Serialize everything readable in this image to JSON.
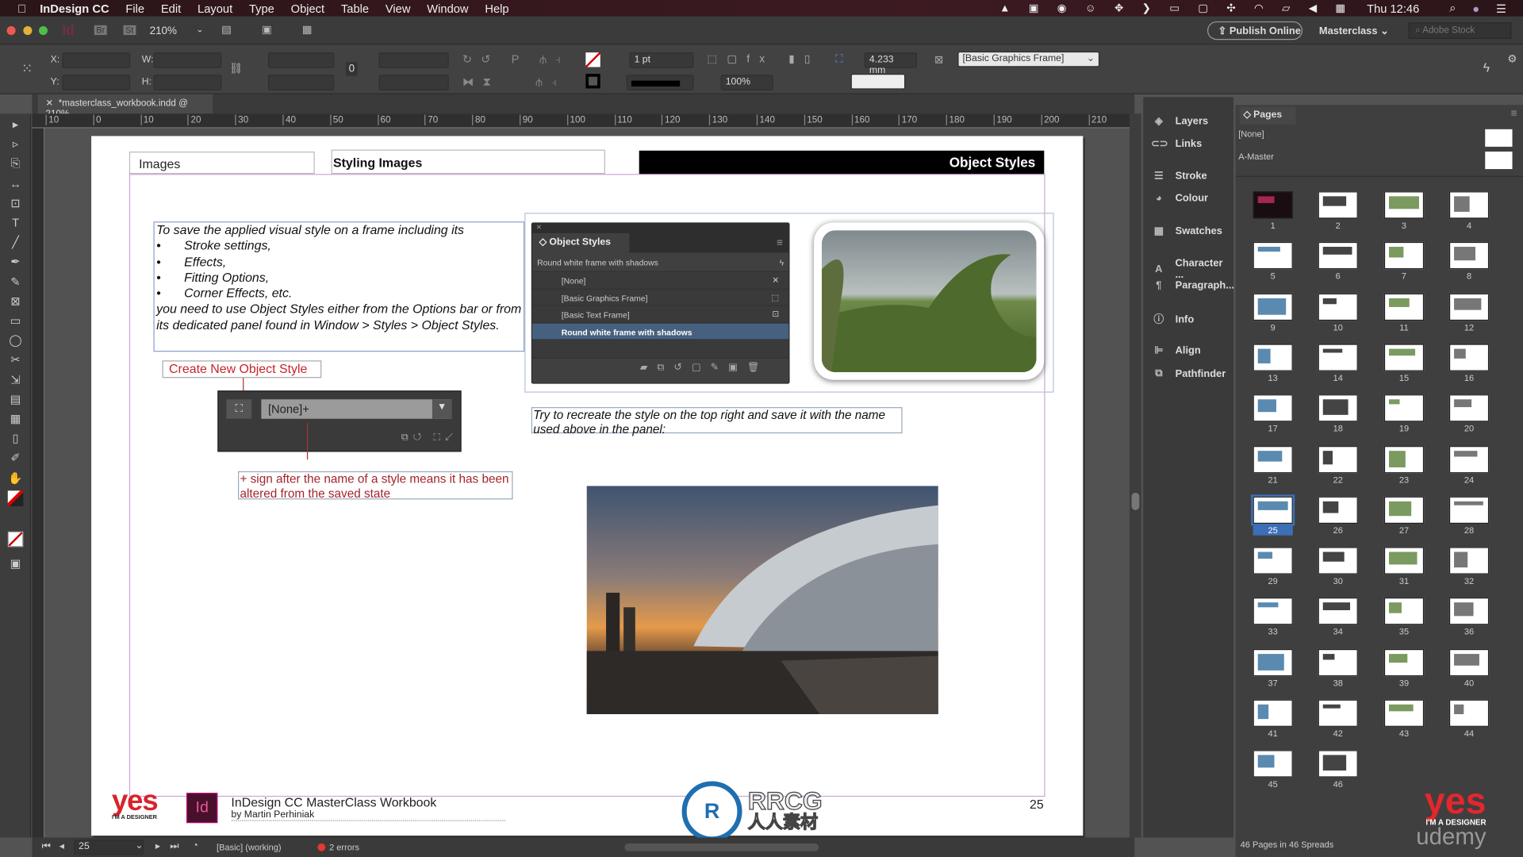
{
  "menubar": {
    "app": "InDesign CC",
    "items": [
      "File",
      "Edit",
      "Layout",
      "Type",
      "Object",
      "Table",
      "View",
      "Window",
      "Help"
    ],
    "clock": "Thu 12:46"
  },
  "appbar": {
    "bridge": "Br",
    "stock_btn": "St",
    "zoom": "210%",
    "publish": "Publish Online",
    "workspace": "Masterclass",
    "search_placeholder": "Adobe Stock"
  },
  "control": {
    "x_label": "X:",
    "y_label": "Y:",
    "w_label": "W:",
    "h_label": "H:",
    "stroke_weight": "1 pt",
    "opacity": "100%",
    "corner": "4.233 mm",
    "object_style": "[Basic Graphics Frame]"
  },
  "document_tab": "*masterclass_workbook.indd @ 210%",
  "ruler_labels": [
    "10",
    "0",
    "10",
    "20",
    "30",
    "40",
    "50",
    "60",
    "70",
    "80",
    "90",
    "100",
    "110",
    "120",
    "130",
    "140",
    "150",
    "160",
    "170",
    "180",
    "190",
    "200",
    "210"
  ],
  "page": {
    "header_left": "Images",
    "header_mid": "Styling Images",
    "header_right": "Object Styles",
    "intro": "To save the applied visual style on a frame including its",
    "bullets": [
      "Stroke settings,",
      "Effects,",
      "Fitting Options,",
      "Corner Effects, etc."
    ],
    "outro": "you need to use Object Styles either from the Options bar or from its dedicated panel found in Window > Styles > Object Styles.",
    "create_label": "Create New Object Style",
    "widget_value": "[None]+",
    "plus_note": "+ sign after the name of a style means it has been altered from the saved state",
    "try_text": "Try to recreate the style on the top right and save it with the name used above in the panel:",
    "footer_title": "InDesign CC MasterClass Workbook",
    "footer_author": "by Martin Perhiniak",
    "page_number": "25",
    "logo_text": "yes",
    "logo_sub": "I'M A DESIGNER",
    "id_logo": "Id"
  },
  "object_styles_panel": {
    "title": "Object Styles",
    "current": "Round white frame with shadows",
    "items": [
      "[None]",
      "[Basic Graphics Frame]",
      "[Basic Text Frame]",
      "Round white frame with shadows"
    ],
    "selected_index": 3
  },
  "dock": [
    "Layers",
    "Links",
    "Stroke",
    "Colour",
    "Swatches",
    "Character ...",
    "Paragraph...",
    "Info",
    "Align",
    "Pathfinder"
  ],
  "dock_icons": [
    "layers-icon",
    "links-icon",
    "stroke-icon",
    "colour-icon",
    "swatches-icon",
    "character-icon",
    "paragraph-icon",
    "info-icon",
    "align-icon",
    "pathfinder-icon"
  ],
  "pages_panel": {
    "title": "Pages",
    "masters": [
      "[None]",
      "A-Master"
    ],
    "page_count": 46,
    "selected_page": 25,
    "summary": "46 Pages in 46 Spreads"
  },
  "status": {
    "page": "25",
    "preflight_profile": "[Basic] (working)",
    "errors": "2 errors"
  },
  "watermark": {
    "text": "RRCG",
    "sub": "人人素材",
    "brand": "udemy"
  },
  "colors": {
    "accent_red": "#c8232c",
    "selection_blue": "#46617f",
    "error": "#e8372c"
  }
}
